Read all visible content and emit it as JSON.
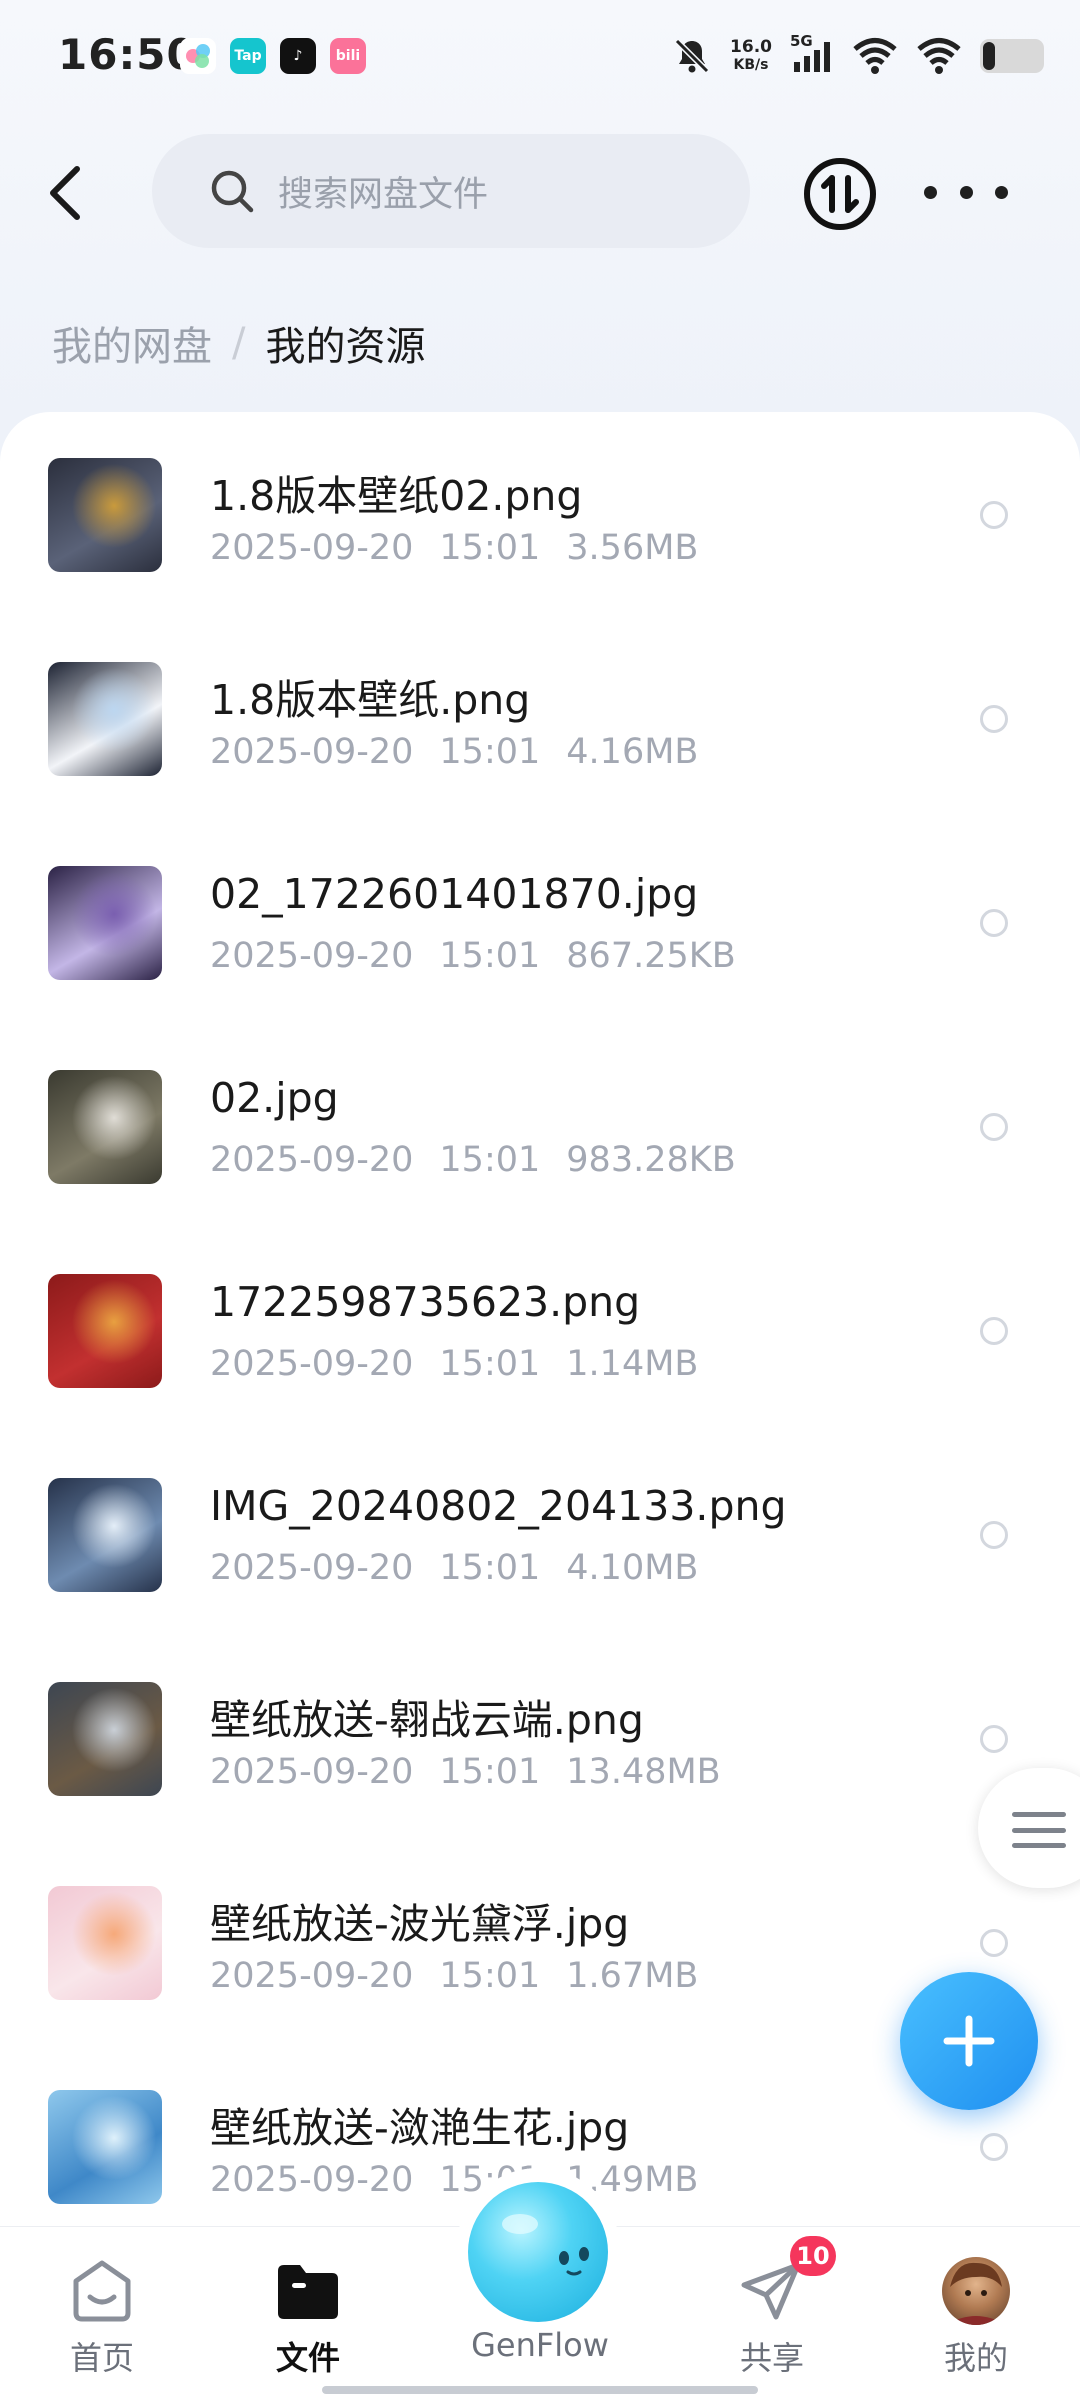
{
  "status_bar": {
    "time": "16:50",
    "net_speed_value": "16.0",
    "net_speed_unit": "KB/s",
    "signal_label": "5G",
    "app_icons": [
      {
        "name": "multicolor-app",
        "text": "",
        "color": "#ffffff"
      },
      {
        "name": "taptap",
        "text": "Tap",
        "color": "#15c5ce"
      },
      {
        "name": "tiktok",
        "text": "♪",
        "color": "#111111"
      },
      {
        "name": "bilibili",
        "text": "bili",
        "color": "#fb7299"
      }
    ]
  },
  "header": {
    "search_placeholder": "搜索网盘文件"
  },
  "breadcrumb": {
    "root": "我的网盘",
    "separator": "/",
    "current": "我的资源"
  },
  "files": [
    {
      "name": "1.8版本壁纸02.png",
      "date": "2025-09-20",
      "time": "15:01",
      "size": "3.56MB",
      "thumb": [
        "#2b2f3d",
        "#c99a3c",
        "#5a6278"
      ]
    },
    {
      "name": "1.8版本壁纸.png",
      "date": "2025-09-20",
      "time": "15:01",
      "size": "4.16MB",
      "thumb": [
        "#1d2333",
        "#bcd6f0",
        "#f2f4f8"
      ]
    },
    {
      "name": "02_1722601401870.jpg",
      "date": "2025-09-20",
      "time": "15:01",
      "size": "867.25KB",
      "thumb": [
        "#2b2245",
        "#7a5fb0",
        "#c3b6e6"
      ]
    },
    {
      "name": "02.jpg",
      "date": "2025-09-20",
      "time": "15:01",
      "size": "983.28KB",
      "thumb": [
        "#3a3a30",
        "#e0ddd6",
        "#7e7a66"
      ]
    },
    {
      "name": "1722598735623.png",
      "date": "2025-09-20",
      "time": "15:01",
      "size": "1.14MB",
      "thumb": [
        "#8c1a1a",
        "#e8a040",
        "#c23030"
      ]
    },
    {
      "name": "IMG_20240802_204133.png",
      "date": "2025-09-20",
      "time": "15:01",
      "size": "4.10MB",
      "thumb": [
        "#26324a",
        "#e4eef8",
        "#6e8bb0"
      ]
    },
    {
      "name": "壁纸放送-翱战云端.png",
      "date": "2025-09-20",
      "time": "15:01",
      "size": "13.48MB",
      "thumb": [
        "#3d4652",
        "#c9cfd6",
        "#6b5a45"
      ]
    },
    {
      "name": "壁纸放送-波光黛浮.jpg",
      "date": "2025-09-20",
      "time": "15:01",
      "size": "1.67MB",
      "thumb": [
        "#f2c9d4",
        "#f6a97a",
        "#f9e6ea"
      ]
    },
    {
      "name": "壁纸放送-潋滟生花.jpg",
      "date": "2025-09-20",
      "time": "15:01",
      "size": "1.49MB",
      "thumb": [
        "#8fc8ec",
        "#dff1fb",
        "#3f88c8"
      ]
    }
  ],
  "bottom_nav": {
    "home": "首页",
    "files": "文件",
    "genflow": "GenFlow",
    "share": "共享",
    "share_badge": "10",
    "mine": "我的"
  },
  "colors": {
    "accent": "#1f8ff0",
    "badge": "#f5365c"
  }
}
